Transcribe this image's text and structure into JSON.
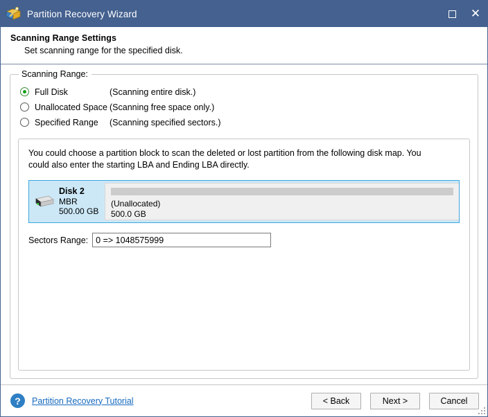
{
  "window": {
    "title": "Partition Recovery Wizard",
    "app_icon": "wizard-wand-icon",
    "controls": {
      "maximize": "maximize-icon",
      "close": "close-icon"
    }
  },
  "header": {
    "title": "Scanning Range Settings",
    "subtitle": "Set scanning range for the specified disk."
  },
  "group": {
    "legend": "Scanning Range:",
    "options": [
      {
        "label": "Full Disk",
        "hint": "(Scanning entire disk.)",
        "checked": true
      },
      {
        "label": "Unallocated Space",
        "hint": "(Scanning free space only.)",
        "checked": false
      },
      {
        "label": "Specified Range",
        "hint": "(Scanning specified sectors.)",
        "checked": false
      }
    ]
  },
  "panel": {
    "description": "You could choose a partition block to scan the deleted or lost partition from the following disk map. You could also enter the starting LBA and Ending LBA directly.",
    "disk": {
      "icon": "hard-disk-icon",
      "name": "Disk 2",
      "scheme": "MBR",
      "capacity": "500.00 GB",
      "selected": true,
      "partition": {
        "label": "(Unallocated)",
        "size": "500.0 GB"
      }
    },
    "sectors": {
      "label": "Sectors Range:",
      "value": "0 => 1048575999",
      "placeholder": "0 => 1048575999"
    }
  },
  "footer": {
    "help_icon": "question-mark-icon",
    "help_link": "Partition Recovery Tutorial",
    "buttons": {
      "back": "< Back",
      "next": "Next >",
      "cancel": "Cancel"
    },
    "resize_grip": "resize-grip-icon"
  },
  "colors": {
    "titlebar": "#44618f",
    "selection": "#cce8f7",
    "selection_border": "#3ba5dd",
    "unallocated_bar": "#cccccc",
    "radio_accent": "#15a015",
    "link": "#1569bf",
    "help_badge": "#2e7fc4"
  }
}
